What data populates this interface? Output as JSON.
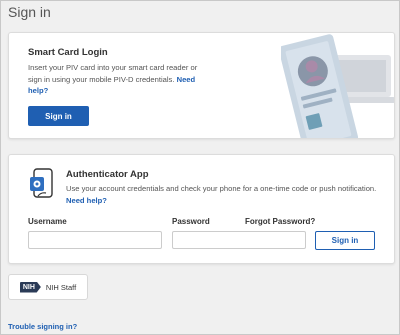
{
  "page": {
    "title": "Sign in"
  },
  "smart_card": {
    "heading": "Smart Card Login",
    "description": "Insert your PIV card into your smart card reader or sign in using your mobile PIV-D credentials.",
    "help_link": "Need help?",
    "sign_in_label": "Sign in"
  },
  "authenticator": {
    "heading": "Authenticator App",
    "description": "Use your account credentials and check your phone for a one-time code or push notification.",
    "help_link": "Need help?",
    "username_label": "Username",
    "username_value": "",
    "password_label": "Password",
    "password_value": "",
    "forgot_password_link": "Forgot Password?",
    "sign_in_label": "Sign in"
  },
  "nih_staff": {
    "logo_text": "NIH",
    "label": "NIH Staff"
  },
  "footer": {
    "trouble_link": "Trouble signing in?"
  },
  "colors": {
    "accent": "#1f5fb2",
    "background": "#f0f0f0",
    "card": "#ffffff"
  },
  "icons": [
    "id-card-illustration",
    "phone-authenticator-icon",
    "nih-logo-icon"
  ]
}
